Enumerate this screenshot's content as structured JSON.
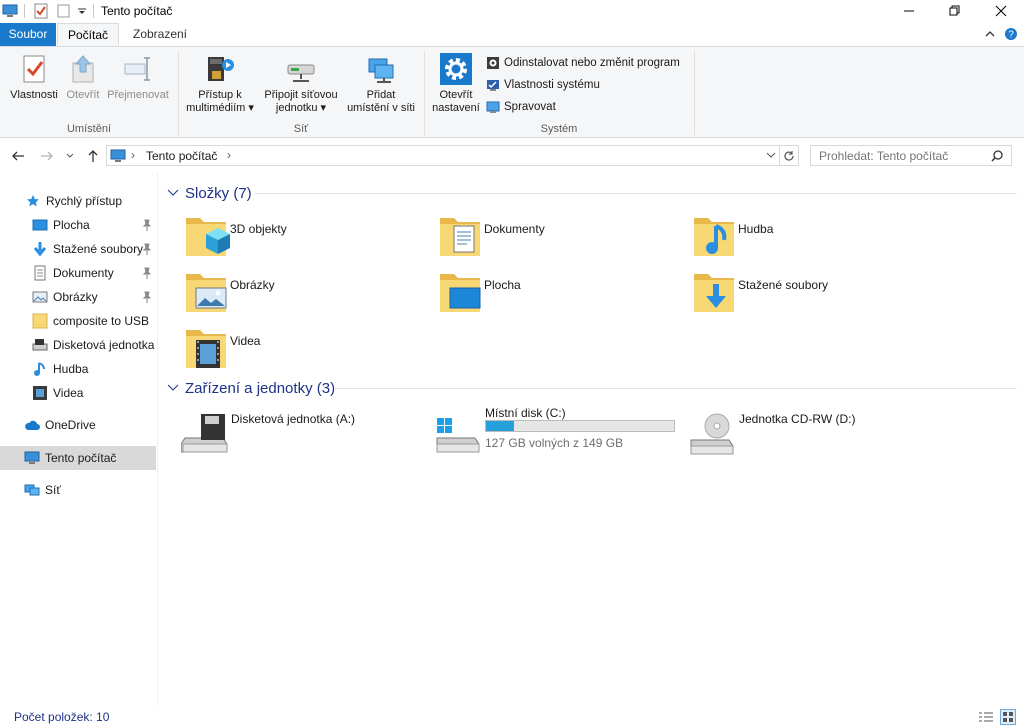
{
  "window": {
    "title": "Tento počítač",
    "controls": [
      "minimize-icon",
      "restore-icon",
      "close-icon"
    ]
  },
  "ribbon": {
    "tabs": [
      {
        "label": "Soubor",
        "state": "file-menu"
      },
      {
        "label": "Počítač",
        "state": "active"
      },
      {
        "label": "Zobrazení",
        "state": "normal"
      }
    ],
    "groups": {
      "umisteni": {
        "label": "Umístění",
        "buttons": {
          "vlastnosti": "Vlastnosti",
          "otevrit": "Otevřít",
          "prejmenovat": "Přejmenovat"
        }
      },
      "sit": {
        "label": "Síť",
        "buttons": {
          "pristup_line1": "Přístup k",
          "pristup_line2": "multimédiím",
          "pripojit_line1": "Připojit síťovou",
          "pripojit_line2": "jednotku",
          "pridat_line1": "Přidat",
          "pridat_line2": "umístění v síti"
        }
      },
      "system": {
        "label": "Systém",
        "buttons": {
          "otevrit_nast_line1": "Otevřít",
          "otevrit_nast_line2": "nastavení",
          "odinstalovat": "Odinstalovat nebo změnit program",
          "vlastnosti_systemu": "Vlastnosti systému",
          "spravovat": "Spravovat"
        }
      }
    }
  },
  "address": {
    "path": "Tento počítač",
    "search_placeholder": "Prohledat: Tento počítač"
  },
  "sidebar": {
    "items": [
      {
        "label": "Rychlý přístup",
        "icon": "star-icon",
        "pinned": false
      },
      {
        "label": "Plocha",
        "icon": "desktop-icon",
        "pinned": true
      },
      {
        "label": "Stažené soubory",
        "icon": "download-icon",
        "pinned": true
      },
      {
        "label": "Dokumenty",
        "icon": "document-icon",
        "pinned": true
      },
      {
        "label": "Obrázky",
        "icon": "pictures-icon",
        "pinned": true
      },
      {
        "label": "composite to USB",
        "icon": "folder-icon",
        "pinned": false
      },
      {
        "label": "Disketová jednotka",
        "icon": "floppy-icon",
        "pinned": false
      },
      {
        "label": "Hudba",
        "icon": "music-icon",
        "pinned": false
      },
      {
        "label": "Videa",
        "icon": "video-icon",
        "pinned": false
      },
      {
        "label": "OneDrive",
        "icon": "cloud-icon",
        "pinned": false
      },
      {
        "label": "Tento počítač",
        "icon": "computer-icon",
        "pinned": false,
        "selected": true
      },
      {
        "label": "Síť",
        "icon": "network-icon",
        "pinned": false
      }
    ]
  },
  "content": {
    "folders_header": "Složky (7)",
    "folders": [
      {
        "label": "3D objekty",
        "icon": "3d-objects-icon"
      },
      {
        "label": "Dokumenty",
        "icon": "documents-folder-icon"
      },
      {
        "label": "Hudba",
        "icon": "music-folder-icon"
      },
      {
        "label": "Obrázky",
        "icon": "pictures-folder-icon"
      },
      {
        "label": "Plocha",
        "icon": "desktop-folder-icon"
      },
      {
        "label": "Stažené soubory",
        "icon": "downloads-folder-icon"
      },
      {
        "label": "Videa",
        "icon": "videos-folder-icon"
      }
    ],
    "drives_header": "Zařízení a jednotky (3)",
    "drives": [
      {
        "label": "Disketová jednotka (A:)",
        "icon": "floppy-drive-icon"
      },
      {
        "label": "Místní disk (C:)",
        "icon": "windows-drive-icon",
        "free_text": "127 GB volných z 149 GB",
        "used_fraction": 0.148
      },
      {
        "label": "Jednotka CD-RW (D:)",
        "icon": "cd-drive-icon"
      }
    ]
  },
  "status": {
    "text": "Počet položek: 10"
  },
  "colors": {
    "accent": "#1979ca",
    "header_text": "#1e3287",
    "folder_yellow": "#f8d775",
    "drive_bar": "#26a0da",
    "selected_bg": "#d9d9d9"
  }
}
